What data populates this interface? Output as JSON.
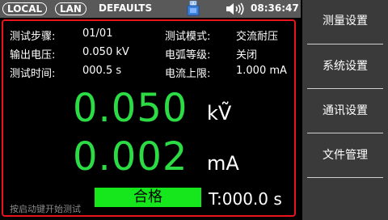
{
  "status_bar": {
    "local": "LOCAL",
    "lan": "LAN",
    "mode": "DEFAULTS",
    "time": "08:36:47",
    "icons": [
      "usb-drive-icon",
      "speaker-volume-icon"
    ]
  },
  "params": {
    "step_label": "测试步骤:",
    "step_value": "01/01",
    "test_mode_label": "测试模式:",
    "test_mode_value": "交流耐压",
    "output_voltage_label": "输出电压:",
    "output_voltage_value": "0.050 kV",
    "arc_level_label": "电弧等级:",
    "arc_level_value": "关闭",
    "test_time_label": "测试时间:",
    "test_time_value": "000.5 s",
    "current_limit_label": "电流上限:",
    "current_limit_value": "1.000 mA"
  },
  "readings": {
    "voltage_value": "0.050",
    "voltage_unit": "kṼ",
    "current_value": "0.002",
    "current_unit": "mA"
  },
  "footer": {
    "hint": "按启动键开始测试",
    "result": "合格",
    "timer": "T:000.0 s"
  },
  "menu": {
    "items": [
      "测量设置",
      "系统设置",
      "通讯设置",
      "文件管理"
    ]
  },
  "colors": {
    "accent_red": "#e8141c",
    "reading_green": "#2bdc45",
    "pass_green": "#16e61c",
    "menu_bg": "#3a3a3a",
    "topbar_bg": "#595959"
  }
}
